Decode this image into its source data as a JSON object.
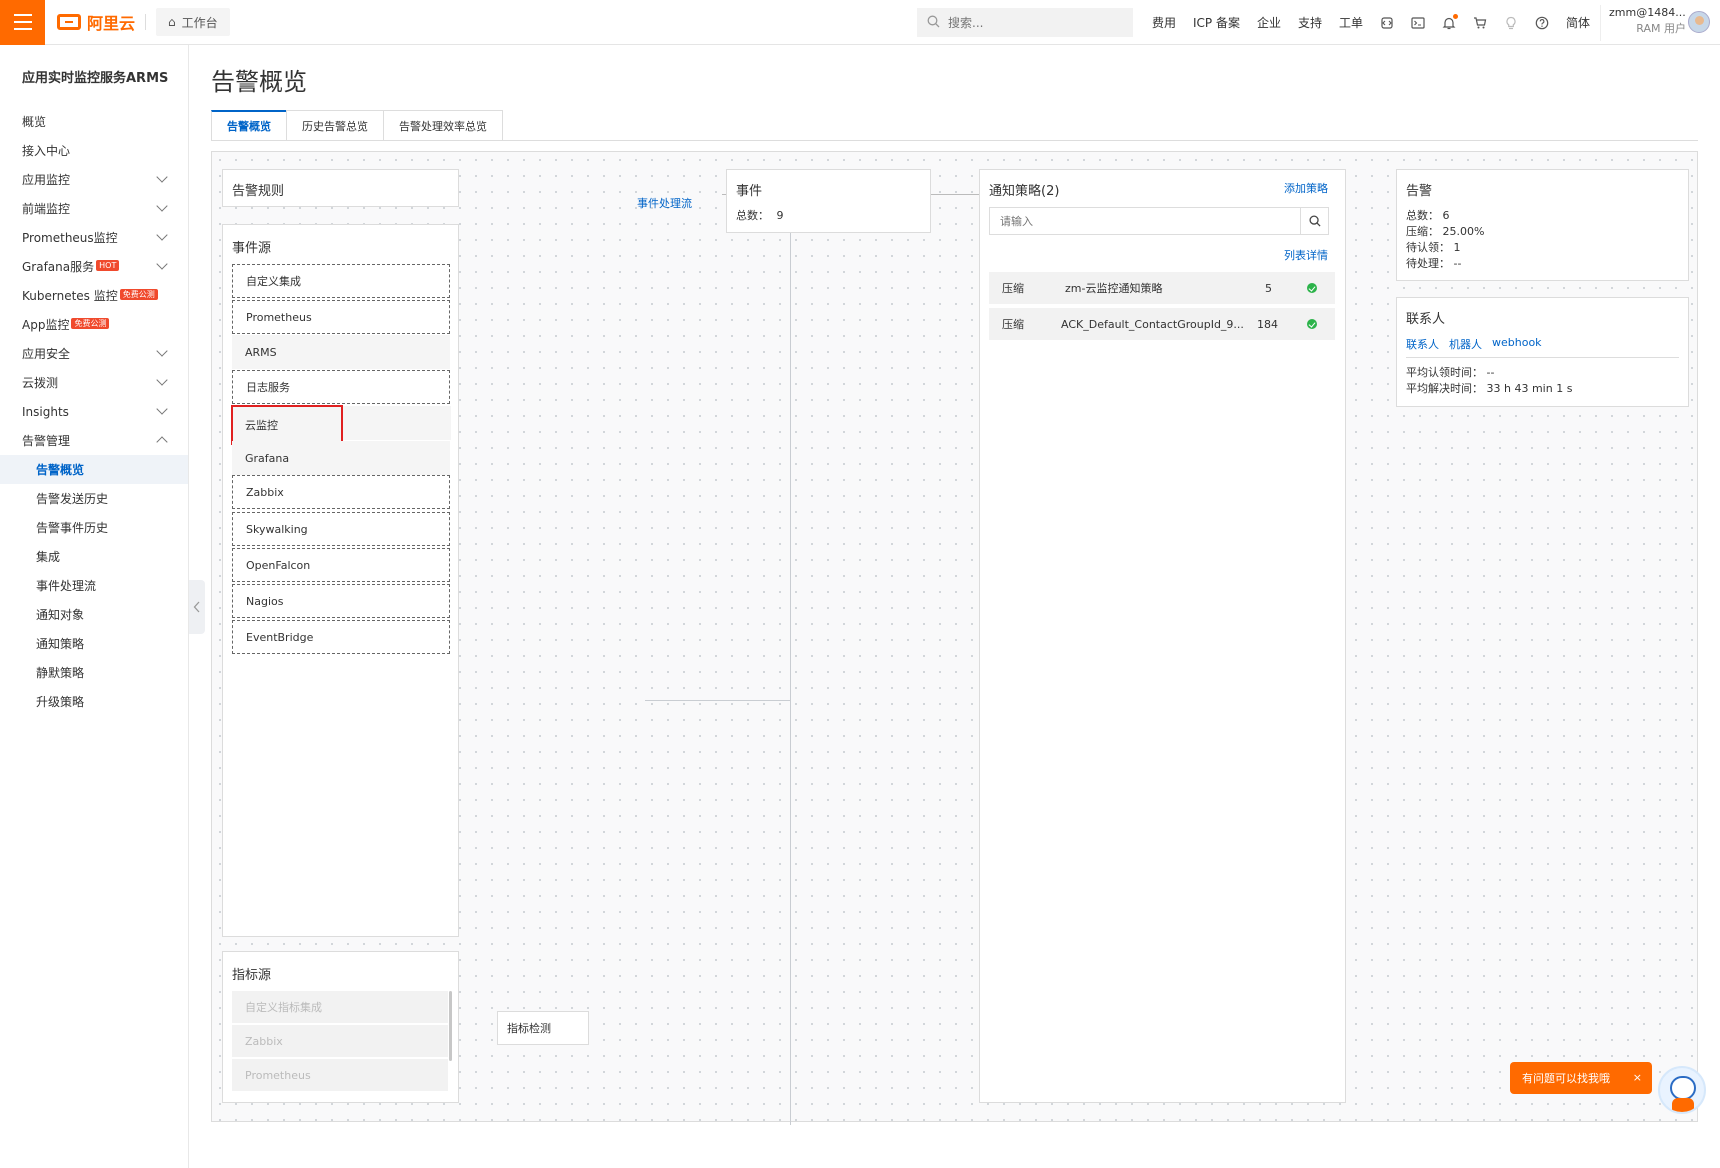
{
  "topbar": {
    "logo_text": "阿里云",
    "workbench": "工作台",
    "search_placeholder": "搜索...",
    "links": [
      "费用",
      "ICP 备案",
      "企业",
      "支持",
      "工单"
    ],
    "lang": "简体",
    "user_name": "zmm@1484...",
    "user_role": "RAM 用户"
  },
  "sidebar": {
    "product_title": "应用实时监控服务ARMS",
    "items": [
      {
        "label": "概览",
        "chevron": false
      },
      {
        "label": "接入中心",
        "chevron": false
      },
      {
        "label": "应用监控",
        "chevron": true
      },
      {
        "label": "前端监控",
        "chevron": true
      },
      {
        "label": "Prometheus监控",
        "chevron": true
      },
      {
        "label": "Grafana服务",
        "tag": "HOT",
        "chevron": true
      },
      {
        "label": "Kubernetes 监控",
        "tag": "免费公测",
        "chevron": false
      },
      {
        "label": "App监控",
        "tag": "免费公测",
        "chevron": false
      },
      {
        "label": "应用安全",
        "chevron": true
      },
      {
        "label": "云拨测",
        "chevron": true
      },
      {
        "label": "Insights",
        "chevron": true
      },
      {
        "label": "告警管理",
        "chevron": true,
        "expanded": true
      }
    ],
    "sub_items": [
      "告警概览",
      "告警发送历史",
      "告警事件历史",
      "集成",
      "事件处理流",
      "通知对象",
      "通知策略",
      "静默策略",
      "升级策略"
    ],
    "active_sub": "告警概览"
  },
  "main": {
    "title": "告警概览",
    "tabs": [
      "告警概览",
      "历史告警总览",
      "告警处理效率总览"
    ]
  },
  "canvas": {
    "alert_rules_title": "告警规则",
    "event_source_title": "事件源",
    "event_sources": [
      "自定义集成",
      "Prometheus",
      "ARMS",
      "日志服务",
      "云监控",
      "Grafana",
      "Zabbix",
      "Skywalking",
      "OpenFalcon",
      "Nagios",
      "EventBridge"
    ],
    "metric_source_title": "指标源",
    "metric_sources": [
      "自定义指标集成",
      "Zabbix",
      "Prometheus"
    ],
    "metric_detect": "指标检测",
    "event_flow_link": "事件处理流",
    "event_box": {
      "title": "事件",
      "total_label": "总数：",
      "total": "9"
    },
    "policy_box": {
      "title": "通知策略(2)",
      "add_link": "添加策略",
      "search_placeholder": "请输入",
      "list_link": "列表详情",
      "rows": [
        {
          "type": "压缩",
          "name": "zm-云监控通知策略",
          "count": "5"
        },
        {
          "type": "压缩",
          "name": "ACK_Default_ContactGroupId_9...",
          "count": "184"
        }
      ]
    },
    "alert_box": {
      "title": "告警",
      "lines": [
        {
          "label": "总数：",
          "value": "6"
        },
        {
          "label": "压缩：",
          "value": "25.00%"
        },
        {
          "label": "待认领：",
          "value": "1"
        },
        {
          "label": "待处理：",
          "value": "--"
        }
      ]
    },
    "contact_box": {
      "title": "联系人",
      "links": [
        "联系人",
        "机器人",
        "webhook"
      ],
      "lines": [
        {
          "label": "平均认领时间：",
          "value": "--"
        },
        {
          "label": "平均解决时间：",
          "value": "33 h 43 min 1 s"
        }
      ]
    }
  },
  "help": {
    "text": "有问题可以找我哦",
    "close": "×"
  }
}
